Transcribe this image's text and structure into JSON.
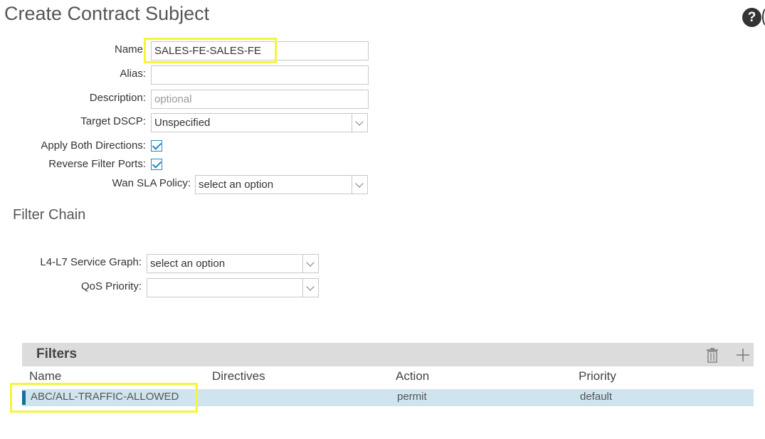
{
  "dialog": {
    "title": "Create Contract Subject",
    "help_glyph": "?"
  },
  "form": {
    "name": {
      "label": "Name",
      "value": "SALES-FE-SALES-FE"
    },
    "alias": {
      "label": "Alias:",
      "value": ""
    },
    "description": {
      "label": "Description:",
      "placeholder": "optional"
    },
    "target_dscp": {
      "label": "Target DSCP:",
      "value": "Unspecified"
    },
    "apply_both_directions": {
      "label": "Apply Both Directions:",
      "checked": true
    },
    "reverse_filter_ports": {
      "label": "Reverse Filter Ports:",
      "checked": true
    },
    "wan_sla_policy": {
      "label": "Wan SLA Policy:",
      "placeholder": "select an option"
    }
  },
  "filter_chain": {
    "title": "Filter Chain",
    "service_graph": {
      "label": "L4-L7 Service Graph:",
      "placeholder": "select an option"
    },
    "qos_priority": {
      "label": "QoS Priority:",
      "value": ""
    }
  },
  "filters": {
    "title": "Filters",
    "columns": [
      "Name",
      "Directives",
      "Action",
      "Priority"
    ],
    "rows": [
      {
        "name": "ABC/ALL-TRAFFIC-ALLOWED",
        "directives": "",
        "action": "permit",
        "priority": "default"
      }
    ]
  },
  "colors": {
    "highlight": "#f5f53a",
    "checkbox": "#1e8ac4",
    "selected_row": "#cfe4ef",
    "header_bar": "#dcdcdc"
  }
}
